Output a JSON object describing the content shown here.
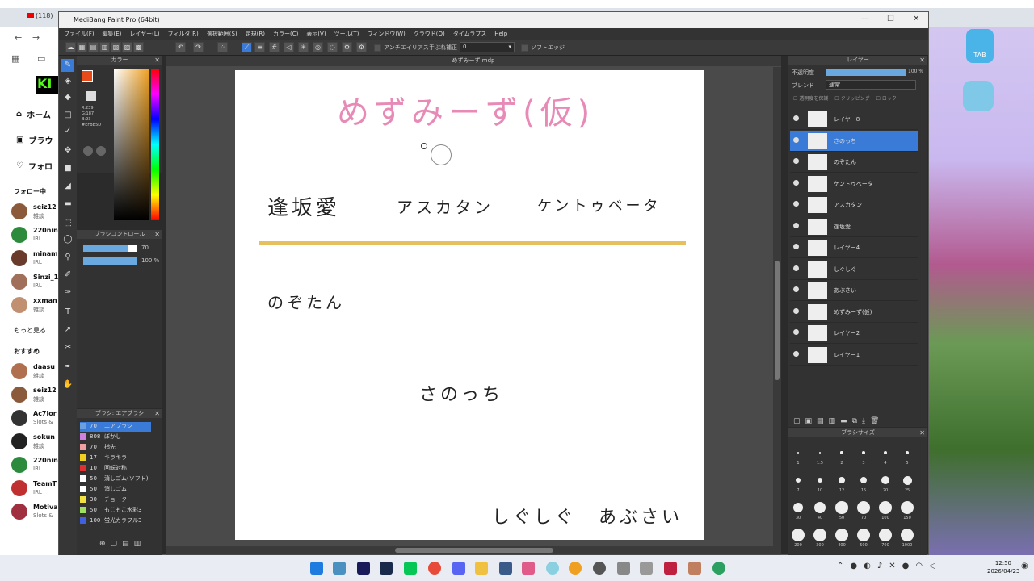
{
  "browser": {
    "tab_label": "(118)",
    "sidebar_nav": [
      "ホーム",
      "ブラウ",
      "フォロ"
    ],
    "following_header": "フォロー中",
    "following": [
      {
        "name": "seiz12",
        "cat": "雑談"
      },
      {
        "name": "220nin",
        "cat": "IRL"
      },
      {
        "name": "minam",
        "cat": "IRL"
      },
      {
        "name": "Sinzi_1",
        "cat": "IRL"
      },
      {
        "name": "xxman",
        "cat": "雑談"
      }
    ],
    "show_more": "もっと見る",
    "recommend_header": "おすすめ",
    "recommended": [
      {
        "name": "daasu",
        "cat": "雑談"
      },
      {
        "name": "seiz12",
        "cat": "雑談"
      },
      {
        "name": "Ac7ior",
        "cat": "Slots &"
      },
      {
        "name": "sokun",
        "cat": "雑談"
      },
      {
        "name": "220nin",
        "cat": "IRL"
      },
      {
        "name": "TeamT",
        "cat": "IRL"
      },
      {
        "name": "Motiva",
        "cat": "Slots &"
      }
    ],
    "game_tab_label": "TAB"
  },
  "app": {
    "title": "MediBang Paint Pro (64bit)",
    "menu": [
      "ファイル(F)",
      "編集(E)",
      "レイヤー(L)",
      "フィルタ(R)",
      "選択範囲(S)",
      "定規(R)",
      "カラー(C)",
      "表示(V)",
      "ツール(T)",
      "ウィンドウ(W)",
      "クラウド(O)",
      "タイムラプス",
      "Help"
    ],
    "toolbar_antialias": "アンチエイリアス",
    "toolbar_correction": "手ぶれ補正",
    "toolbar_correction_val": "0",
    "toolbar_softedge": "ソフトエッジ",
    "canvas_title": "めずみーず.mdp",
    "color_panel": {
      "title": "カラー",
      "values": [
        "R:239",
        "G:187",
        "B:93",
        "#EFBB5D"
      ],
      "current_color": "#e84a1a"
    },
    "brush_control": {
      "title": "ブラシコントロール",
      "size_value": "70",
      "opacity_value": "100 %"
    },
    "brush_list": {
      "title": "ブラシ: エアブラシ",
      "items": [
        {
          "size": "70",
          "name": "エアブラシ",
          "color": "#6aa0e0"
        },
        {
          "size": "808",
          "name": "ぼかし",
          "color": "#d080e0"
        },
        {
          "size": "70",
          "name": "指先",
          "color": "#f0a0a0"
        },
        {
          "size": "17",
          "name": "キラキラ",
          "color": "#f0d020"
        },
        {
          "size": "10",
          "name": "回転対称",
          "color": "#e03030"
        },
        {
          "size": "50",
          "name": "消しゴム(ソフト)",
          "color": "#ffffff"
        },
        {
          "size": "50",
          "name": "消しゴム",
          "color": "#ffffff"
        },
        {
          "size": "30",
          "name": "チョーク",
          "color": "#f0e040"
        },
        {
          "size": "50",
          "name": "もこもこ水彩3",
          "color": "#a0e060"
        },
        {
          "size": "100",
          "name": "蛍光カラフル3",
          "color": "#4060e0"
        }
      ]
    },
    "canvas_texts": {
      "title": "めずみーず(仮)",
      "name1": "逢坂愛",
      "name2": "アスカタン",
      "name3": "ケントゥベータ",
      "name4": "のぞたん",
      "name5": "さのっち",
      "name6": "しぐしぐ",
      "name7": "あぶさい"
    },
    "layer_panel": {
      "title": "レイヤー",
      "opacity_label": "不透明度",
      "opacity_value": "100 %",
      "blend_label": "ブレンド",
      "blend_value": "通常",
      "protect_label": "透明度を保護",
      "clipping_label": "クリッピング",
      "lock_label": "ロック",
      "layers": [
        "レイヤー8",
        "さのっち",
        "のぞたん",
        "ケントゥベータ",
        "アスカタン",
        "逢坂愛",
        "レイヤー4",
        "しぐしぐ",
        "あぶさい",
        "めずみーず(仮)",
        "レイヤー2",
        "レイヤー1"
      ],
      "selected_index": 1
    },
    "brush_size": {
      "title": "ブラシサイズ",
      "sizes": [
        "1",
        "1.5",
        "2",
        "3",
        "4",
        "5",
        "7",
        "10",
        "12",
        "15",
        "20",
        "25",
        "30",
        "40",
        "50",
        "70",
        "100",
        "150",
        "200",
        "300",
        "400",
        "500",
        "700",
        "1000"
      ]
    }
  },
  "taskbar": {
    "time": "12:50",
    "date": "2026/04/23"
  }
}
